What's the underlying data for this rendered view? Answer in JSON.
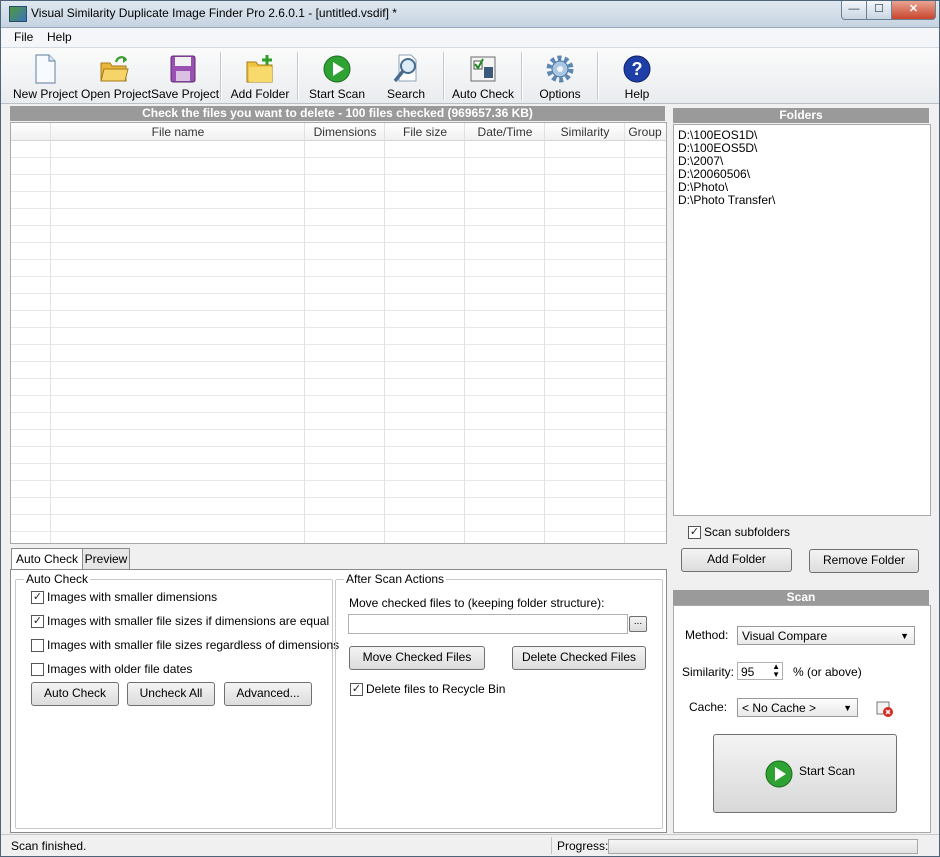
{
  "window": {
    "title": "Visual Similarity Duplicate Image Finder Pro 2.6.0.1 - [untitled.vsdif] *",
    "min": "—",
    "max": "☐",
    "close": "✕"
  },
  "menu": [
    "File",
    "Help"
  ],
  "toolbar": {
    "new_project": "New Project",
    "open_project": "Open Project",
    "save_project": "Save Project",
    "add_folder": "Add Folder",
    "start_scan": "Start Scan",
    "search": "Search",
    "auto_check": "Auto Check",
    "options": "Options",
    "help": "Help"
  },
  "files": {
    "header": "Check the files you want to delete - 100 files checked (969657.36 KB)",
    "columns": [
      "File name",
      "Dimensions",
      "File size",
      "Date/Time",
      "Similarity",
      "Group"
    ]
  },
  "folders": {
    "header": "Folders",
    "items": [
      "D:\\100EOS1D\\",
      "D:\\100EOS5D\\",
      "D:\\2007\\",
      "D:\\20060506\\",
      "D:\\Photo\\",
      "D:\\Photo Transfer\\"
    ],
    "scan_subfolders": "Scan subfolders",
    "add_folder": "Add Folder",
    "remove_folder": "Remove Folder"
  },
  "tabs": [
    "Auto Check",
    "Preview"
  ],
  "auto_check": {
    "title": "Auto Check",
    "options": [
      {
        "label": "Images with smaller dimensions",
        "checked": true
      },
      {
        "label": "Images with smaller file sizes if dimensions are equal",
        "checked": true
      },
      {
        "label": "Images with smaller file sizes regardless of dimensions",
        "checked": false
      },
      {
        "label": "Images with older file dates",
        "checked": false
      }
    ],
    "auto_check_btn": "Auto Check",
    "uncheck_all_btn": "Uncheck All",
    "advanced_btn": "Advanced..."
  },
  "after_scan": {
    "title": "After Scan Actions",
    "move_label": "Move checked files to (keeping folder structure):",
    "move_path": "",
    "browse": "...",
    "move_btn": "Move Checked Files",
    "delete_btn": "Delete Checked Files",
    "recycle": "Delete files to Recycle Bin"
  },
  "scan": {
    "header": "Scan",
    "method_label": "Method:",
    "method_value": "Visual Compare",
    "similarity_label": "Similarity:",
    "similarity_value": "95",
    "similarity_suffix": "% (or above)",
    "cache_label": "Cache:",
    "cache_value": "< No Cache >",
    "start_scan": "Start Scan"
  },
  "status": {
    "text": "Scan finished.",
    "progress_label": "Progress:"
  }
}
